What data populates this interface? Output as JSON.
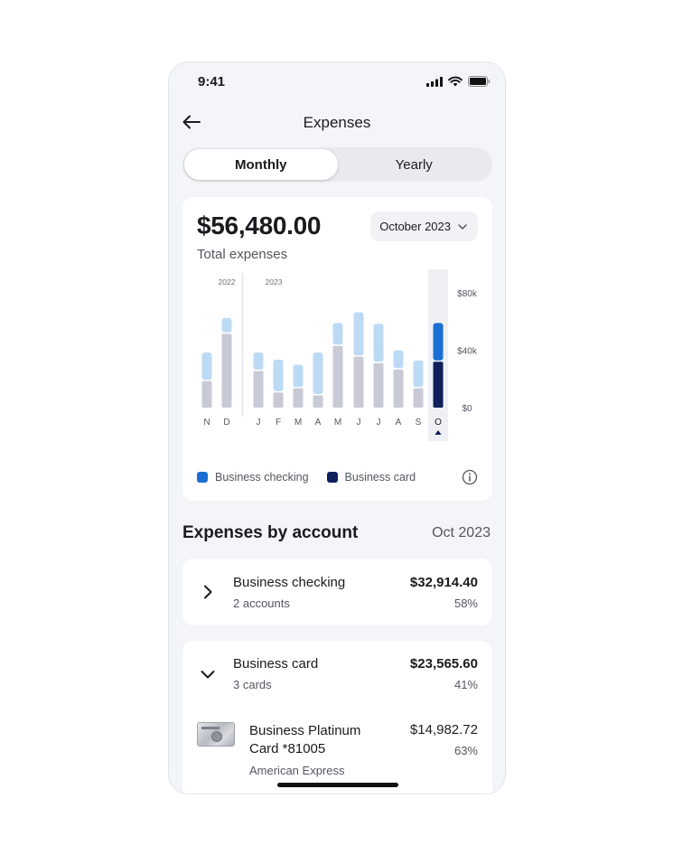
{
  "status_bar": {
    "time": "9:41"
  },
  "header": {
    "title": "Expenses"
  },
  "segmented": {
    "monthly": "Monthly",
    "yearly": "Yearly",
    "selected": "Monthly"
  },
  "summary": {
    "total": "$56,480.00",
    "total_label": "Total expenses",
    "period": "October 2023"
  },
  "chart_data": {
    "type": "bar",
    "stacked": true,
    "categories": [
      "N",
      "D",
      "J",
      "F",
      "M",
      "A",
      "M",
      "J",
      "J",
      "A",
      "S",
      "O"
    ],
    "year_labels": [
      {
        "label": "2022",
        "start_index": 0
      },
      {
        "label": "2023",
        "start_index": 2
      }
    ],
    "selected_index": 11,
    "ylim": [
      0,
      80000
    ],
    "yticks": [
      {
        "value": 0,
        "label": "$0"
      },
      {
        "value": 40000,
        "label": "$40k"
      },
      {
        "value": 80000,
        "label": "$80k"
      }
    ],
    "series": [
      {
        "name": "Business card",
        "values": [
          18500,
          51500,
          25500,
          10500,
          13500,
          8500,
          43000,
          35500,
          31000,
          26500,
          13500,
          32000
        ]
      },
      {
        "name": "Business checking",
        "values": [
          19000,
          10000,
          12000,
          22000,
          15500,
          29000,
          15000,
          30000,
          26500,
          12500,
          18500,
          26000
        ]
      }
    ]
  },
  "legend": {
    "business_checking": "Business checking",
    "business_card": "Business card"
  },
  "colors": {
    "checking_selected": "#1b6ed4",
    "card_selected": "#0f1f5c",
    "checking": "#bddaf5",
    "card": "#c9cad6",
    "highlight": "#eef0f4"
  },
  "section": {
    "title": "Expenses by account",
    "date": "Oct 2023"
  },
  "accounts": [
    {
      "name": "Business checking",
      "sub": "2 accounts",
      "amount": "$32,914.40",
      "percent": "58%",
      "expanded": false
    },
    {
      "name": "Business card",
      "sub": "3 cards",
      "amount": "$23,565.60",
      "percent": "41%",
      "expanded": true,
      "items": [
        {
          "name": "Business Platinum Card *81005",
          "issuer": "American Express",
          "amount": "$14,982.72",
          "percent": "63%"
        }
      ]
    }
  ]
}
